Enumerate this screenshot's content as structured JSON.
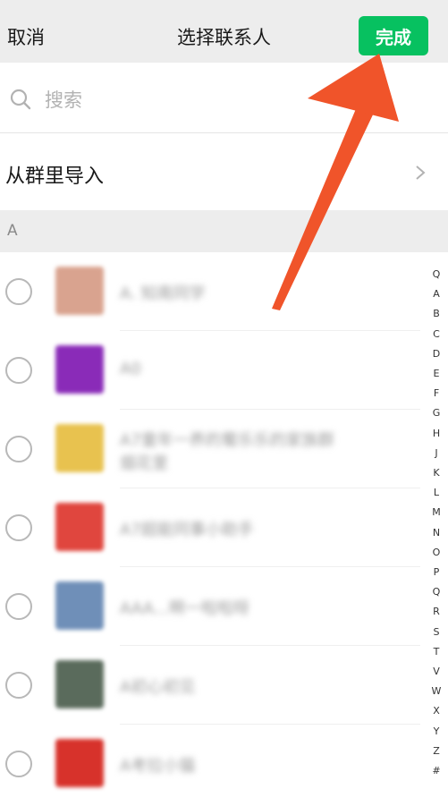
{
  "header": {
    "cancel_label": "取消",
    "title": "选择联系人",
    "done_label": "完成"
  },
  "search": {
    "placeholder": "搜索"
  },
  "import_row": {
    "label": "从群里导入"
  },
  "section": {
    "letter": "A"
  },
  "contacts": [
    {
      "name": "A. 知南同学",
      "avatar_color": "#d9a38f"
    },
    {
      "name": "A0",
      "avatar_color": "#8a2bb8"
    },
    {
      "name": "A7童年一养的蜀乐乐的家族群",
      "line2": "烟花里",
      "avatar_color": "#e8c24f"
    },
    {
      "name": "A7超能同事小助手",
      "avatar_color": "#e0463e"
    },
    {
      "name": "AAA...啊一啦啦呀",
      "avatar_color": "#6f8fb8"
    },
    {
      "name": "A初心初见",
      "avatar_color": "#5a6b5c"
    },
    {
      "name": "A考拉小猫",
      "avatar_color": "#d7322b"
    }
  ],
  "index_letters": [
    "Q",
    "A",
    "B",
    "C",
    "D",
    "E",
    "F",
    "G",
    "H",
    "J",
    "K",
    "L",
    "M",
    "N",
    "O",
    "P",
    "Q",
    "R",
    "S",
    "T",
    "V",
    "W",
    "X",
    "Y",
    "Z",
    "#"
  ],
  "colors": {
    "accent": "#07c160",
    "arrow": "#f0542a",
    "background": "#ededed"
  }
}
